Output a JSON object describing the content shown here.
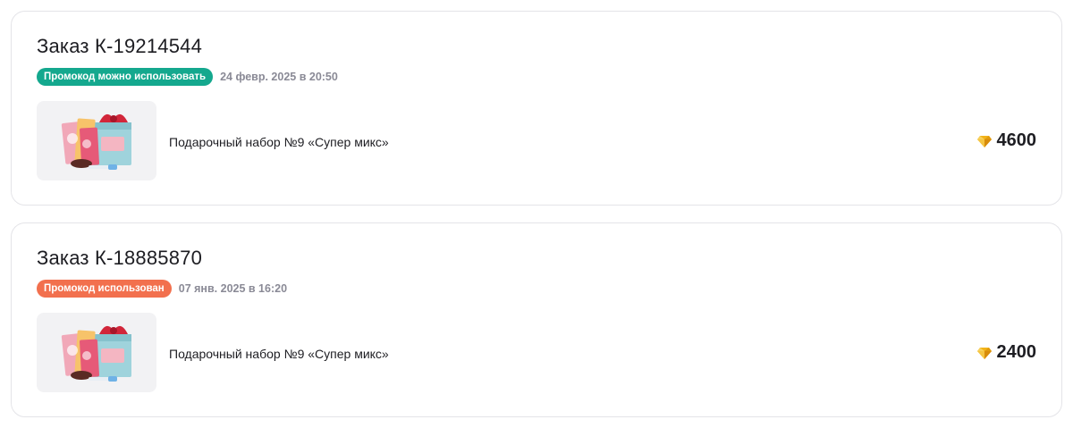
{
  "orders": [
    {
      "title": "Заказ К-19214544",
      "badge": "Промокод можно использовать",
      "badge_color": "#14a88e",
      "date": "24 февр. 2025 в 20:50",
      "product": {
        "name": "Подарочный набор №9 «Супер микс»",
        "image_icon": "gift-set-image"
      },
      "price": "4600",
      "currency_icon": "gem-icon"
    },
    {
      "title": "Заказ К-18885870",
      "badge": "Промокод использован",
      "badge_color": "#f2704e",
      "date": "07 янв. 2025 в 16:20",
      "product": {
        "name": "Подарочный набор №9 «Супер микс»",
        "image_icon": "gift-set-image"
      },
      "price": "2400",
      "currency_icon": "gem-icon"
    }
  ]
}
